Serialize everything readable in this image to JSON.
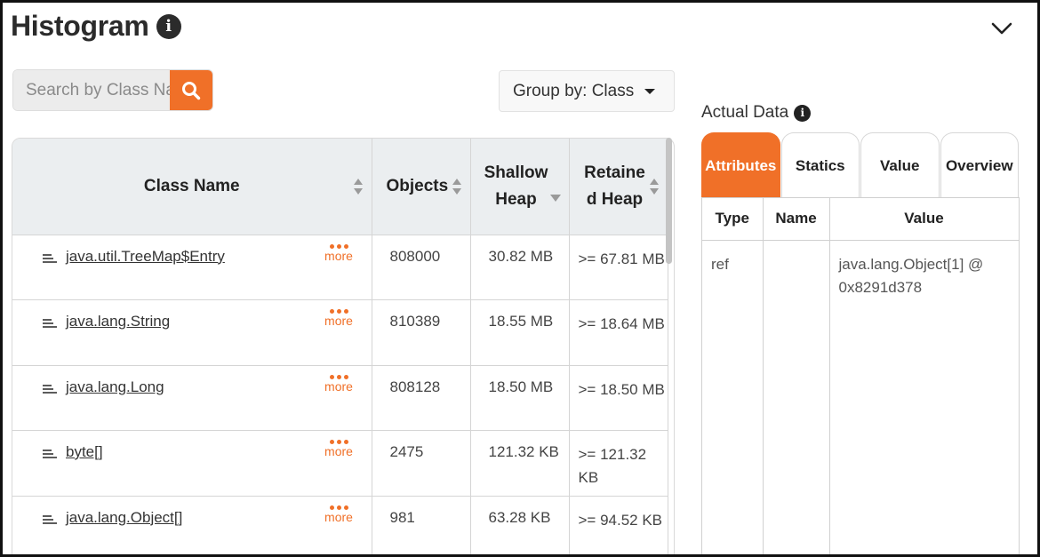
{
  "header": {
    "title": "Histogram"
  },
  "search": {
    "placeholder": "Search by Class Name"
  },
  "groupby": {
    "label": "Group by: Class"
  },
  "histogram": {
    "columns": [
      "Class Name",
      "Objects",
      "Shallow Heap",
      "Retained Heap"
    ],
    "more_label": "more",
    "rows": [
      {
        "name": "java.util.TreeMap$Entry",
        "objects": "808000",
        "shallow": "30.82 MB",
        "retained": ">= 67.81 MB"
      },
      {
        "name": "java.lang.String",
        "objects": "810389",
        "shallow": "18.55 MB",
        "retained": ">= 18.64 MB"
      },
      {
        "name": "java.lang.Long",
        "objects": "808128",
        "shallow": "18.50 MB",
        "retained": ">= 18.50 MB"
      },
      {
        "name": "byte[]",
        "objects": "2475",
        "shallow": "121.32 KB",
        "retained": ">= 121.32 KB"
      },
      {
        "name": "java.lang.Object[]",
        "objects": "981",
        "shallow": "63.28 KB",
        "retained": ">= 94.52 KB"
      }
    ]
  },
  "actual_data": {
    "label": "Actual Data",
    "tabs": [
      "Attributes",
      "Statics",
      "Value",
      "Overview"
    ],
    "columns": [
      "Type",
      "Name",
      "Value"
    ],
    "row": {
      "type": "ref",
      "name": "",
      "value": "java.lang.Object[1] @ 0x8291d378"
    }
  },
  "colors": {
    "accent": "#f07028",
    "header_bg": "#ebeef0"
  }
}
